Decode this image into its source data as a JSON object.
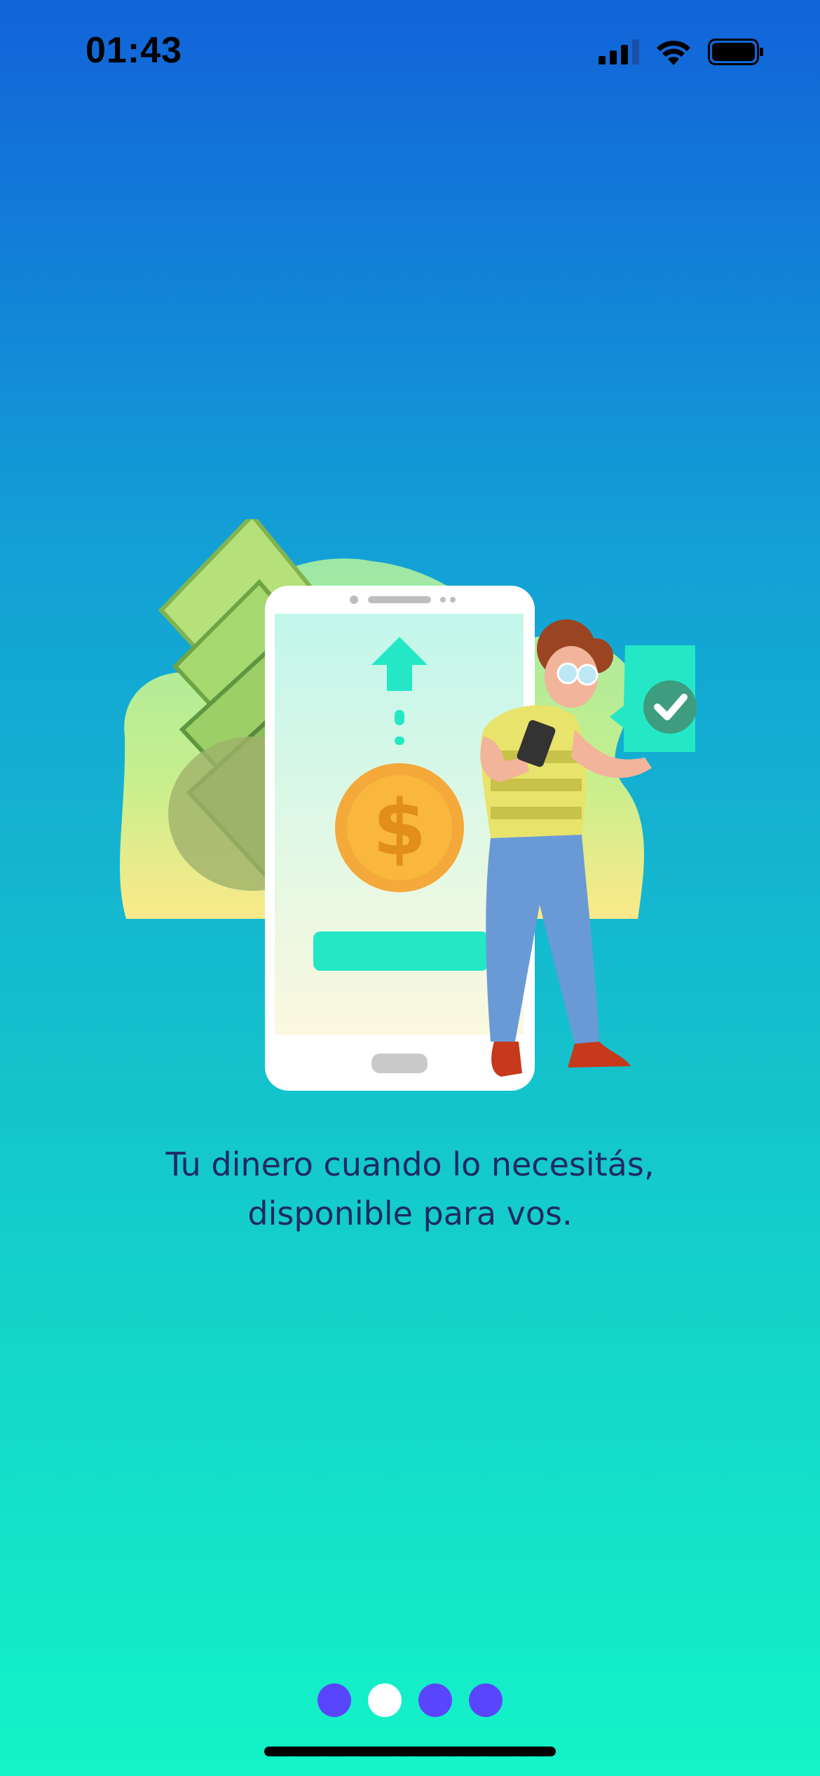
{
  "status_bar": {
    "time": "01:43",
    "icons": [
      "cellular-signal-icon",
      "wifi-icon",
      "battery-icon"
    ]
  },
  "illustration": {
    "description_icons": [
      "money-bills-icon",
      "phone-icon",
      "upload-arrow-icon",
      "dollar-coin-icon",
      "person-icon",
      "check-badge-icon"
    ],
    "colors": {
      "coin": "#f5b23a",
      "accent": "#24e8c5",
      "bush": "#b4ec8a"
    }
  },
  "caption": {
    "line1": "Tu dinero cuando lo necesitás,",
    "line2": "disponible para vos."
  },
  "pager": {
    "count": 4,
    "active_index": 1
  },
  "colors": {
    "gradient_top": "#1263d9",
    "gradient_bottom": "#13f4c7",
    "dot": "#5a45ff",
    "dot_active": "#ffffff",
    "caption_text": "#1f2a60"
  }
}
